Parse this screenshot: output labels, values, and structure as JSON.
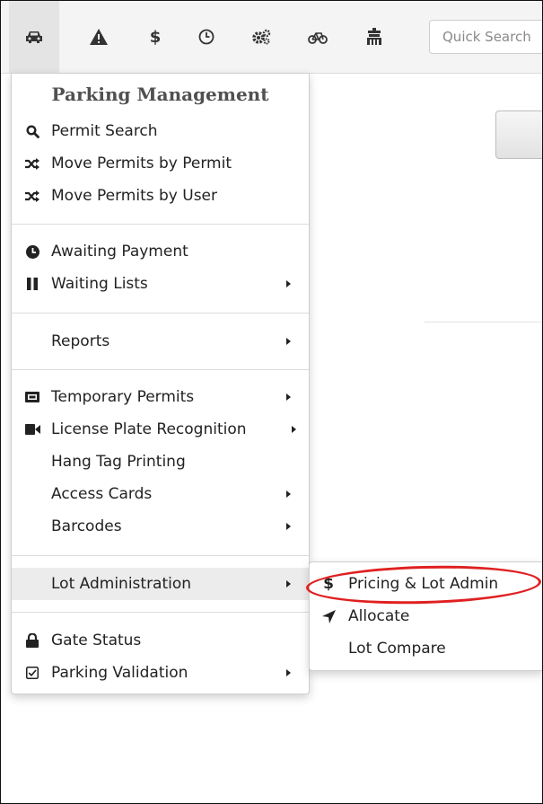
{
  "topbar": {
    "icons": [
      "car-icon",
      "warning-icon",
      "dollar-icon",
      "clock-icon",
      "cogs-icon",
      "bicycle-icon",
      "gate-icon"
    ],
    "dollar_glyph": "$",
    "search_placeholder": "Quick Search"
  },
  "menu": {
    "header": "Parking Management",
    "items": {
      "permit_search": "Permit Search",
      "move_by_permit": "Move Permits by Permit",
      "move_by_user": "Move Permits by User",
      "awaiting_payment": "Awaiting Payment",
      "waiting_lists": "Waiting Lists",
      "reports": "Reports",
      "temporary_permits": "Temporary Permits",
      "lpr": "License Plate Recognition",
      "hang_tag": "Hang Tag Printing",
      "access_cards": "Access Cards",
      "barcodes": "Barcodes",
      "lot_admin": "Lot Administration",
      "gate_status": "Gate Status",
      "parking_validation": "Parking Validation"
    }
  },
  "submenu": {
    "pricing": "Pricing & Lot Admin",
    "pricing_glyph": "$",
    "allocate": "Allocate",
    "lot_compare": "Lot Compare"
  },
  "colors": {
    "highlight_circle": "#e02020",
    "active_row": "#ececec",
    "topbar_bg": "#f4f4f4"
  }
}
